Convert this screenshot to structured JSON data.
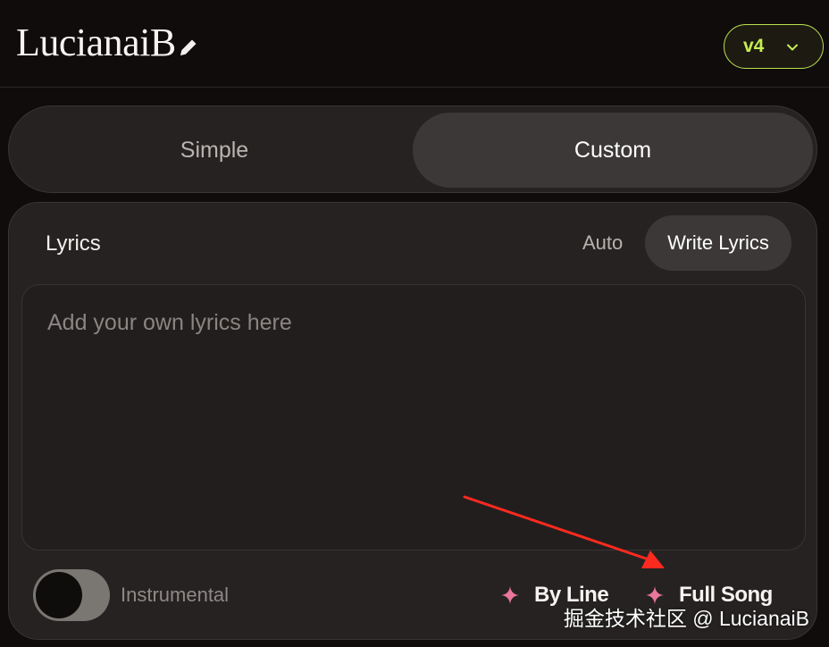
{
  "header": {
    "title": "LucianaiB",
    "edit_icon": "pencil-icon",
    "version_label": "v4",
    "version_icon": "chevron-down-icon"
  },
  "mode_switch": {
    "tabs": [
      {
        "label": "Simple",
        "active": false
      },
      {
        "label": "Custom",
        "active": true
      }
    ]
  },
  "lyrics_panel": {
    "label": "Lyrics",
    "mode_auto": "Auto",
    "mode_write": "Write Lyrics",
    "input_placeholder": "Add your own lyrics here",
    "input_value": ""
  },
  "footer": {
    "instrumental_label": "Instrumental",
    "instrumental_on": false,
    "by_line_label": "By Line",
    "full_song_label": "Full Song",
    "sparkle_icon": "sparkle-icon",
    "sparkle_color": "#e8779a"
  },
  "annotation": {
    "arrow_color": "#ff2a1f"
  },
  "watermark": "掘金技术社区 @ LucianaiB",
  "colors": {
    "accent": "#c5ee52",
    "background": "#100c0c",
    "panel": "#262222",
    "active_tab": "#3d3838"
  }
}
